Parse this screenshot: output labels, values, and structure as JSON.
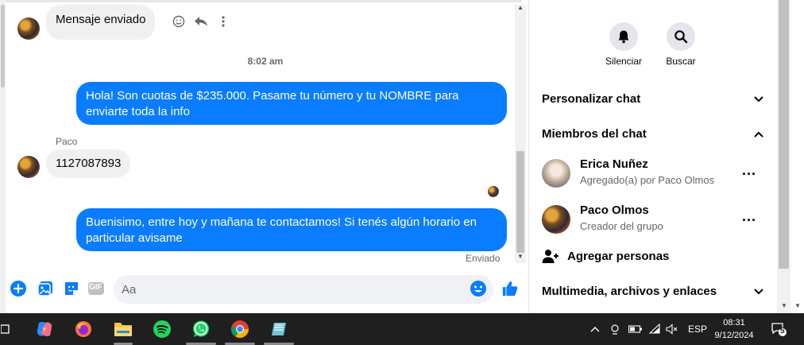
{
  "chat": {
    "messages": [
      {
        "direction": "in",
        "text": "Mensaje enviado"
      },
      {
        "direction": "out",
        "text": "Hola! Son cuotas de $235.000. Pasame tu número y tu NOMBRE para enviarte toda la info"
      },
      {
        "direction": "in",
        "text": "1127087893"
      },
      {
        "direction": "out",
        "text": "Buenisimo, entre hoy y mañana te contactamos! Si tenés algún horario en particular avisame"
      }
    ],
    "timestamp": "8:02 am",
    "sender_name": "Paco",
    "delivery_status": "Enviado"
  },
  "composer": {
    "placeholder": "Aa",
    "icons": [
      "plus-icon",
      "image-icon",
      "sticker-icon",
      "gif-icon",
      "emoji-icon",
      "like-icon"
    ],
    "gif_label": "GIF"
  },
  "panel": {
    "mute_label": "Silenciar",
    "search_label": "Buscar",
    "customize_label": "Personalizar chat",
    "members_label": "Miembros del chat",
    "members": [
      {
        "name": "Erica Nuñez",
        "subtitle": "Agregado(a) por Paco Olmos",
        "more": "..."
      },
      {
        "name": "Paco Olmos",
        "subtitle": "Creador del grupo",
        "more": "..."
      }
    ],
    "add_people_label": "Agregar personas",
    "media_label": "Multimedia, archivos y enlaces"
  },
  "taskbar": {
    "apps": [
      "copilot-icon",
      "firefox-icon",
      "file-explorer-icon",
      "spotify-icon",
      "whatsapp-icon",
      "chrome-icon",
      "notepad-icon"
    ],
    "language": "ESP",
    "time": "08:31",
    "date": "9/12/2024",
    "notification_count": "5"
  },
  "colors": {
    "accent": "#0a7cff",
    "incoming_bubble": "#f0f0f0",
    "taskbar": "#1f1f1f"
  }
}
